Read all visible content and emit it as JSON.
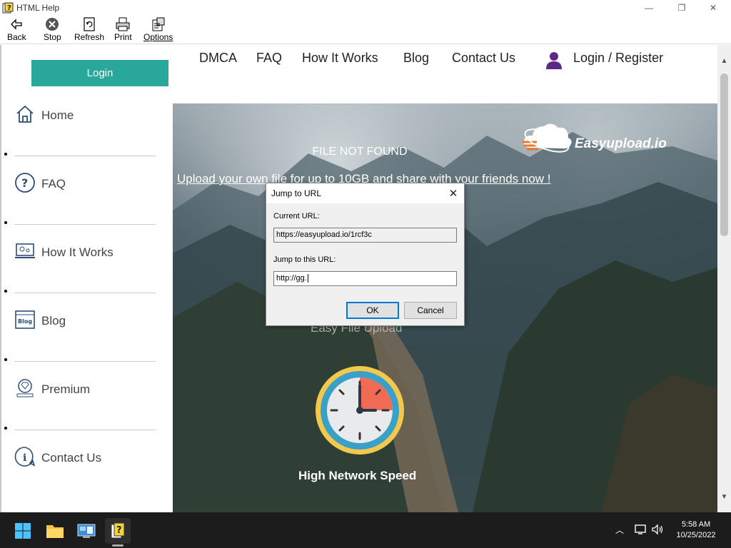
{
  "window": {
    "title": "HTML Help",
    "min_glyph": "—",
    "max_glyph": "❐",
    "close_glyph": "✕"
  },
  "toolbar": {
    "back": "Back",
    "stop": "Stop",
    "refresh": "Refresh",
    "print": "Print",
    "options": "Options"
  },
  "sidebar": {
    "login": "Login",
    "items": [
      {
        "label": "Home",
        "icon": "home-icon"
      },
      {
        "label": "FAQ",
        "icon": "question-icon"
      },
      {
        "label": "How It Works",
        "icon": "laptop-icon"
      },
      {
        "label": "Blog",
        "icon": "blog-icon"
      },
      {
        "label": "Premium",
        "icon": "diamond-icon"
      },
      {
        "label": "Contact Us",
        "icon": "info-chat-icon"
      }
    ]
  },
  "topnav": {
    "items": [
      "DMCA",
      "FAQ",
      "How It Works",
      "Blog",
      "Contact Us"
    ],
    "login_register": "Login / Register"
  },
  "hero": {
    "brand": "Easyupload.io",
    "title": "FILE NOT FOUND",
    "link": "Upload your own file for up to 10GB and share with your friends now !",
    "subtitle": "Easy File Upload",
    "feature": "High Network Speed"
  },
  "dialog": {
    "title": "Jump to URL",
    "current_label": "Current URL:",
    "current_value": "https://easyupload.io/1rcf3c",
    "jump_label": "Jump to this URL:",
    "jump_value": "http://gg.",
    "ok": "OK",
    "cancel": "Cancel"
  },
  "taskbar": {
    "time": "5:58 AM",
    "date": "10/25/2022"
  },
  "colors": {
    "accent": "#2aa79b",
    "user_icon": "#5b2a86",
    "taskbar": "#1c1c1c"
  }
}
